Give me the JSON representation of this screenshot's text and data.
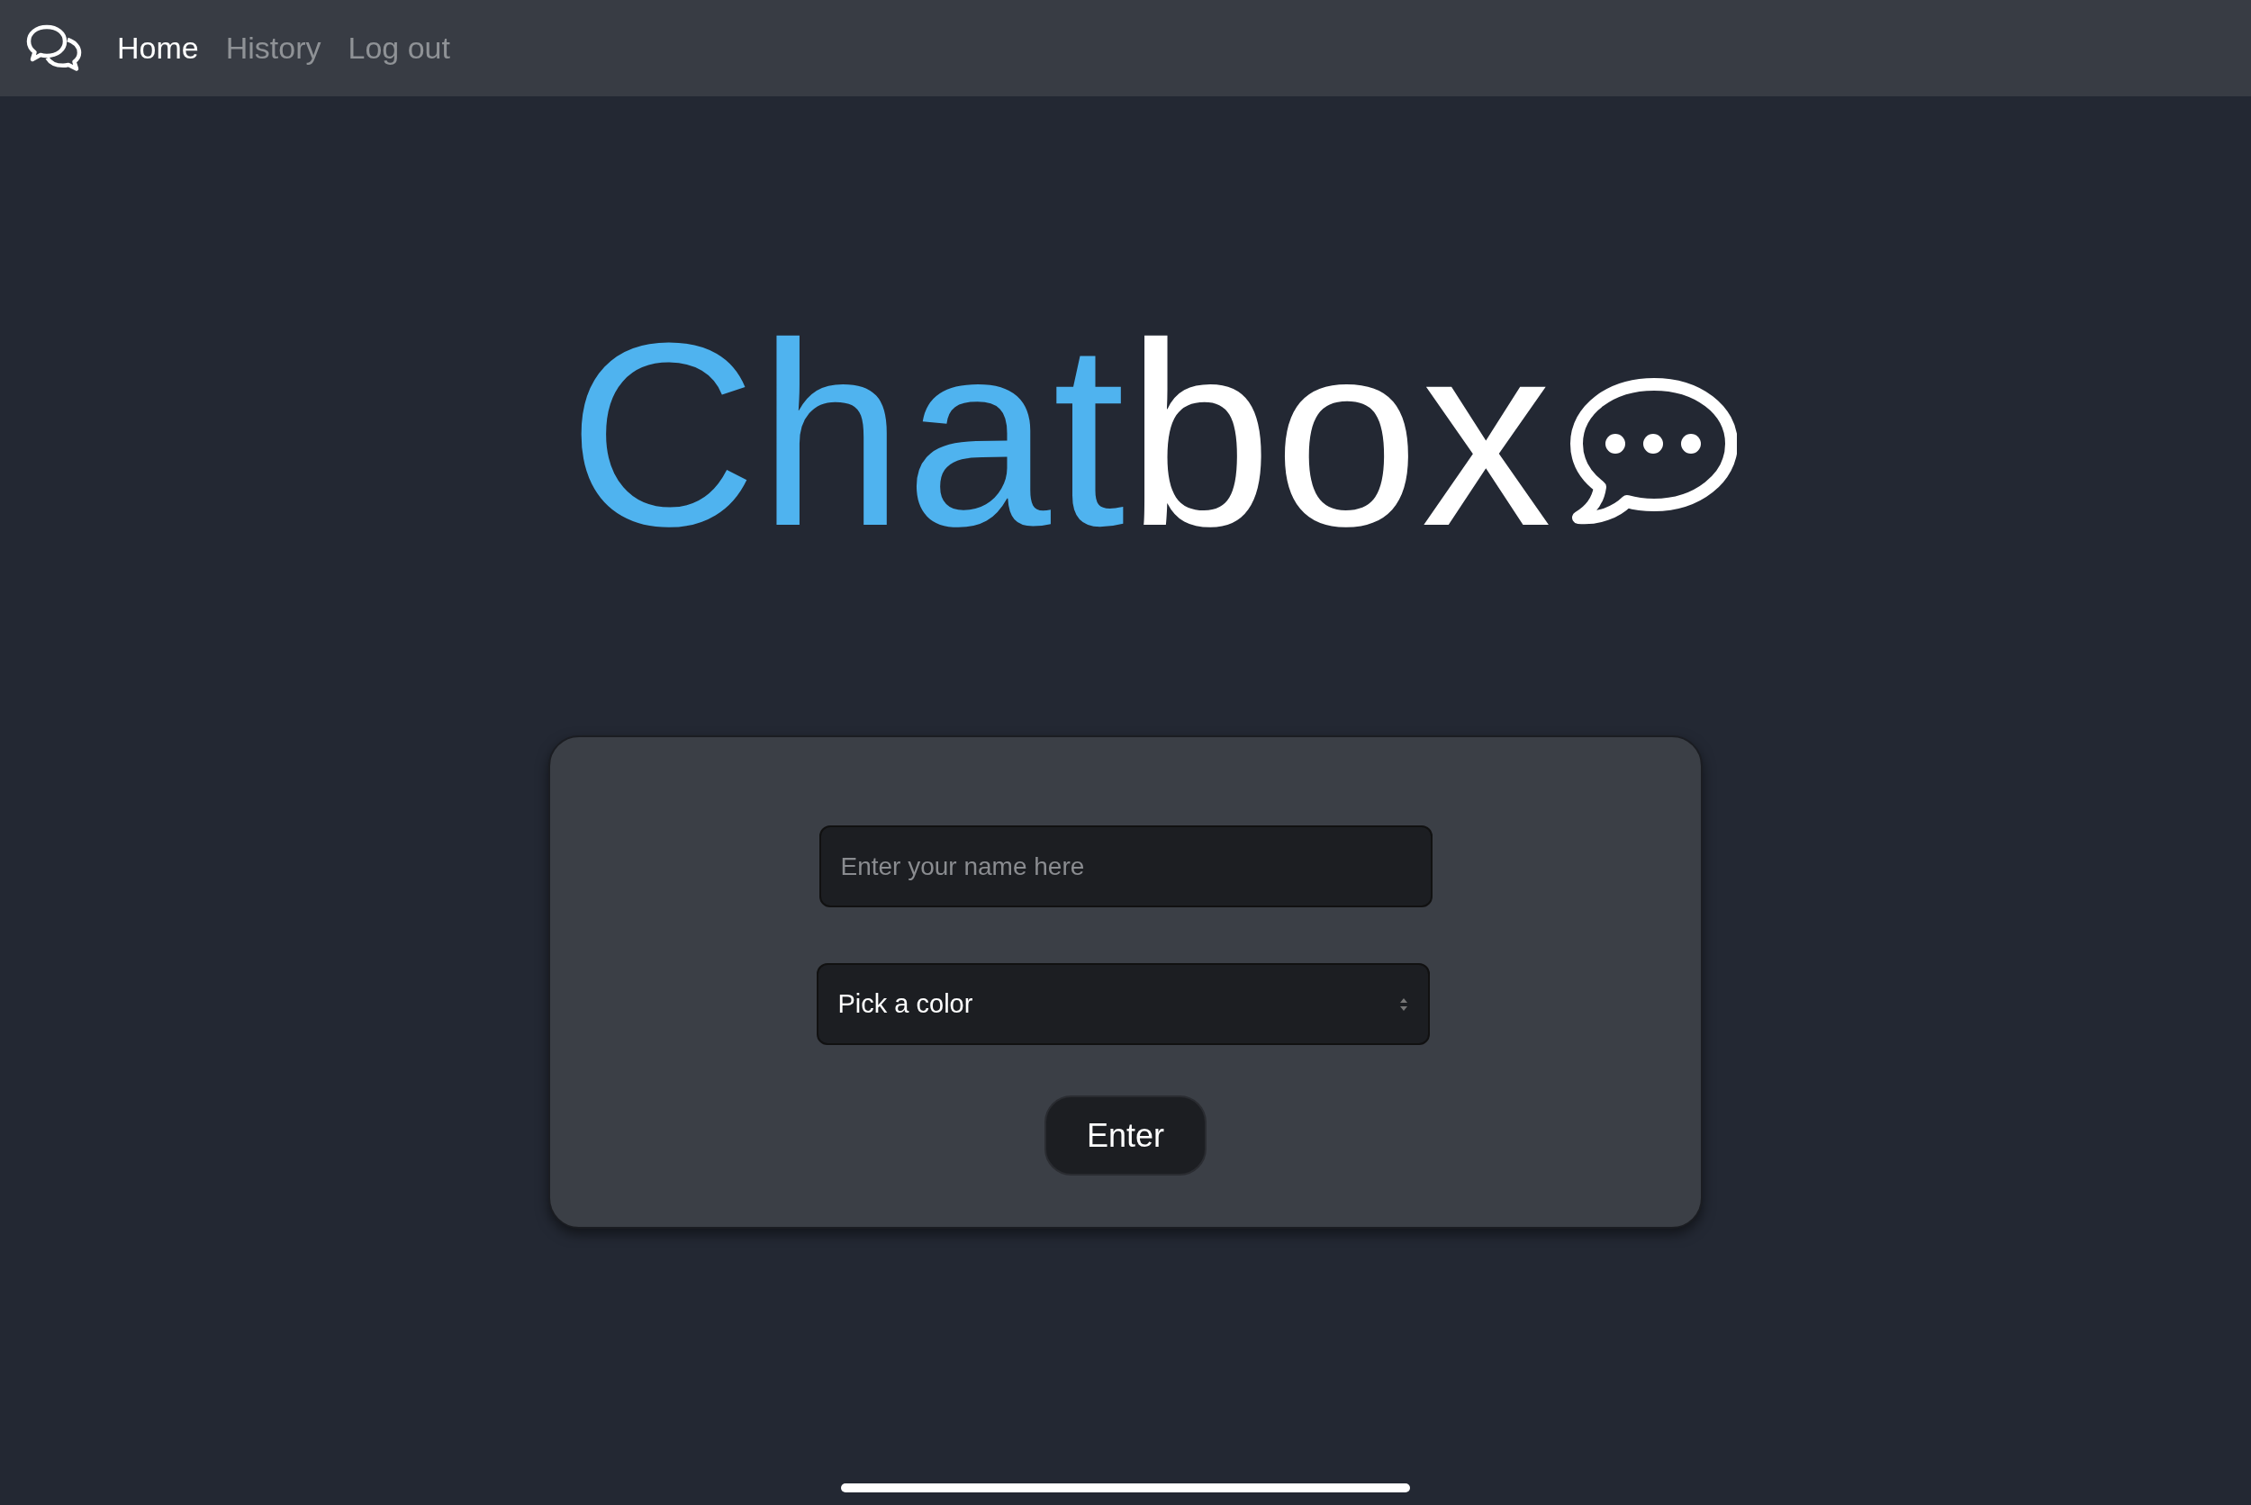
{
  "nav": {
    "items": [
      {
        "label": "Home",
        "selected": true
      },
      {
        "label": "History",
        "selected": false
      },
      {
        "label": "Log out",
        "selected": false
      }
    ]
  },
  "logo": {
    "parts": [
      {
        "text": "Chat",
        "color": "#4fb3ef"
      },
      {
        "text": "box",
        "color": "#ffffff"
      }
    ]
  },
  "form": {
    "name_field": {
      "placeholder": "Enter your name here"
    },
    "color_select": {
      "value": "Pick a color"
    },
    "button": "Enter"
  }
}
